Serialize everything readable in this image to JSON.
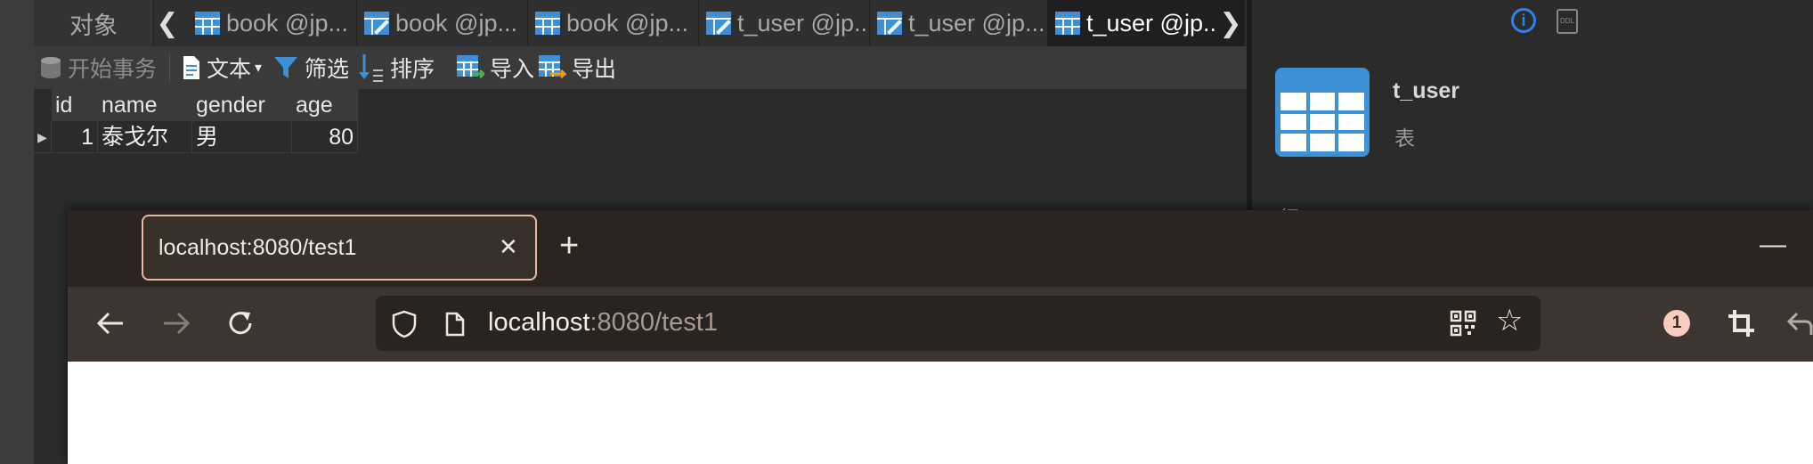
{
  "navicat": {
    "objects_tab": "对象",
    "tabs": [
      {
        "label": "book @jp...",
        "icon": "table-icon",
        "active": false
      },
      {
        "label": "book @jp...",
        "icon": "table-design-icon",
        "active": false
      },
      {
        "label": "book @jp...",
        "icon": "table-icon",
        "active": false
      },
      {
        "label": "t_user @jp...",
        "icon": "table-design-icon",
        "active": false
      },
      {
        "label": "t_user @jp...",
        "icon": "table-design-icon",
        "active": false
      },
      {
        "label": "t_user @jp...",
        "icon": "table-icon",
        "active": true
      }
    ],
    "toolbar": {
      "begin_transaction": "开始事务",
      "text": "文本",
      "filter": "筛选",
      "sort": "排序",
      "import": "导入",
      "export": "导出"
    },
    "grid": {
      "columns": [
        "id",
        "name",
        "gender",
        "age"
      ],
      "rows": [
        [
          "1",
          "泰戈尔",
          "男",
          "80"
        ]
      ]
    },
    "info_panel": {
      "title": "t_user",
      "subtitle": "表",
      "partial_label": "行"
    },
    "accent": "#3d8fd6"
  },
  "firefox": {
    "tab_title": "localhost:8080/test1",
    "url_host": "localhost",
    "url_rest": ":8080/test1",
    "badge_count": "1",
    "accent": "#e7b8a2"
  }
}
